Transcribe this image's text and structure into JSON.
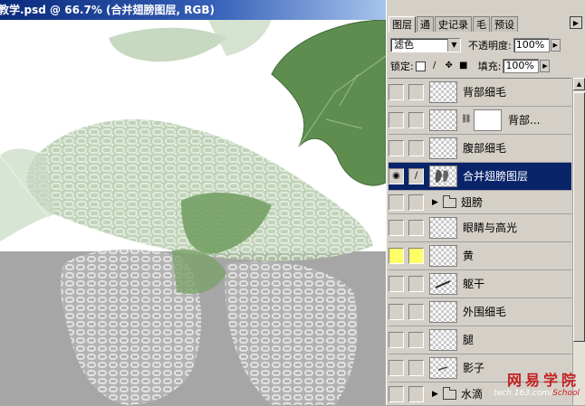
{
  "document": {
    "title": "教学.psd @ 66.7% (合并翅膀图层, RGB)"
  },
  "palette": {
    "tabs": [
      {
        "label": "图层",
        "active": true
      },
      {
        "label": "通",
        "active": false
      },
      {
        "label": "史记录",
        "active": false
      },
      {
        "label": "毛",
        "active": false
      },
      {
        "label": "预设",
        "active": false
      }
    ],
    "blend_mode": "滤色",
    "opacity_label": "不透明度:",
    "opacity_value": "100%",
    "lock_label": "锁定:",
    "fill_label": "填充:",
    "fill_value": "100%"
  },
  "layers": [
    {
      "name": "背部细毛",
      "type": "layer",
      "visible": false,
      "selected": false,
      "color": ""
    },
    {
      "name": "背部...",
      "type": "masked",
      "visible": false,
      "selected": false,
      "color": ""
    },
    {
      "name": "腹部细毛",
      "type": "layer",
      "visible": false,
      "selected": false,
      "color": ""
    },
    {
      "name": "合并翅膀图层",
      "type": "layer",
      "visible": true,
      "selected": true,
      "color": ""
    },
    {
      "name": "翅膀",
      "type": "group",
      "visible": false,
      "selected": false,
      "color": ""
    },
    {
      "name": "眼睛与高光",
      "type": "layer",
      "visible": false,
      "selected": false,
      "color": ""
    },
    {
      "name": "黄",
      "type": "layer",
      "visible": false,
      "selected": false,
      "color": "yellow"
    },
    {
      "name": "躯干",
      "type": "layer",
      "visible": false,
      "selected": false,
      "color": ""
    },
    {
      "name": "外围细毛",
      "type": "layer",
      "visible": false,
      "selected": false,
      "color": ""
    },
    {
      "name": "腿",
      "type": "layer",
      "visible": false,
      "selected": false,
      "color": ""
    },
    {
      "name": "影子",
      "type": "layer",
      "visible": false,
      "selected": false,
      "color": ""
    },
    {
      "name": "水滴",
      "type": "group",
      "visible": false,
      "selected": false,
      "color": ""
    }
  ],
  "watermark": {
    "brand": "网易学院",
    "url_prefix": "tech.163.com/",
    "url_suffix": "School"
  },
  "colors": {
    "selection": "#0a246a",
    "panel_bg": "#d4d0c8",
    "canvas_gray": "#a6a6a6",
    "label_yellow": "#ffff66"
  }
}
